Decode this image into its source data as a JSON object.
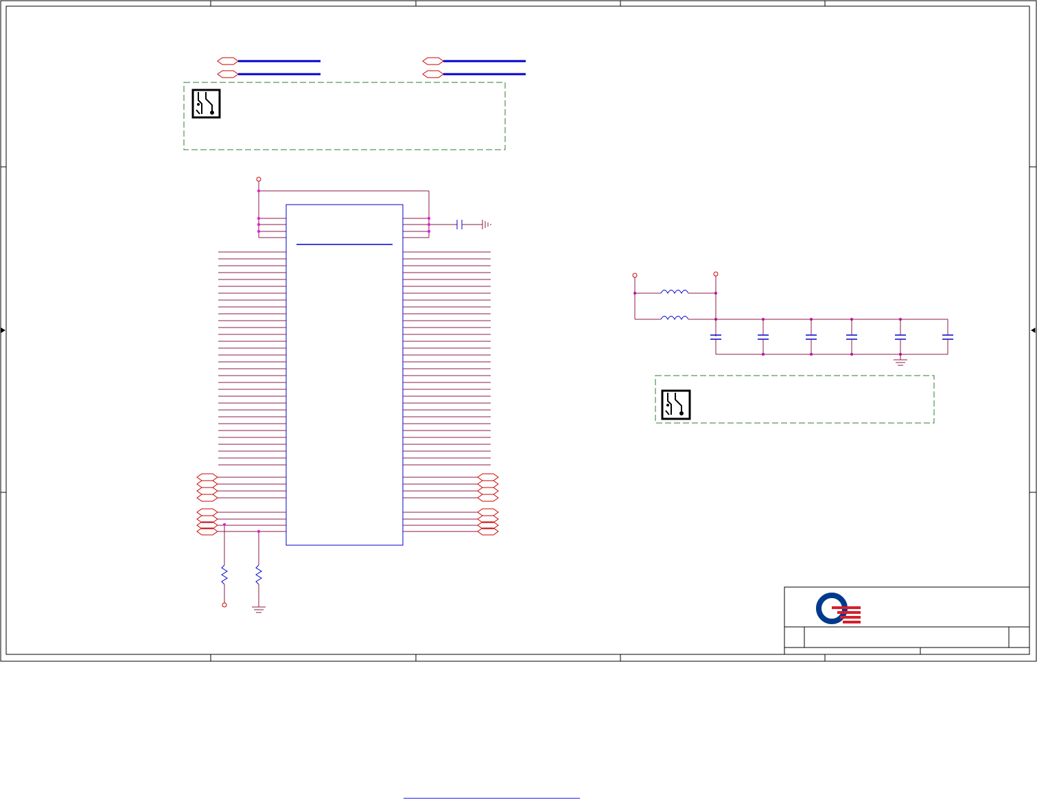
{
  "sheet": {
    "title": "",
    "zone_columns": [
      "",
      "",
      "",
      "",
      ""
    ],
    "zone_rows": [
      "",
      "",
      "",
      ""
    ]
  },
  "title_block": {
    "company": "",
    "title": "",
    "size": "",
    "document_number": "",
    "revision": "",
    "date": "",
    "sheet": ""
  },
  "notes": [
    {
      "id": "note-1",
      "text": ""
    },
    {
      "id": "note-2",
      "text": ""
    }
  ],
  "footer_link": {
    "text": ""
  },
  "colors": {
    "wire": "#8b1a4a",
    "pin": "#cc0000",
    "part_outline": "#0000cc",
    "net_label_line": "#0000cc",
    "junction": "#e020e0",
    "note_border": "#2e7d2e",
    "frame": "#000000",
    "logo_blue": "#003a8c",
    "logo_red": "#d71f2a"
  }
}
